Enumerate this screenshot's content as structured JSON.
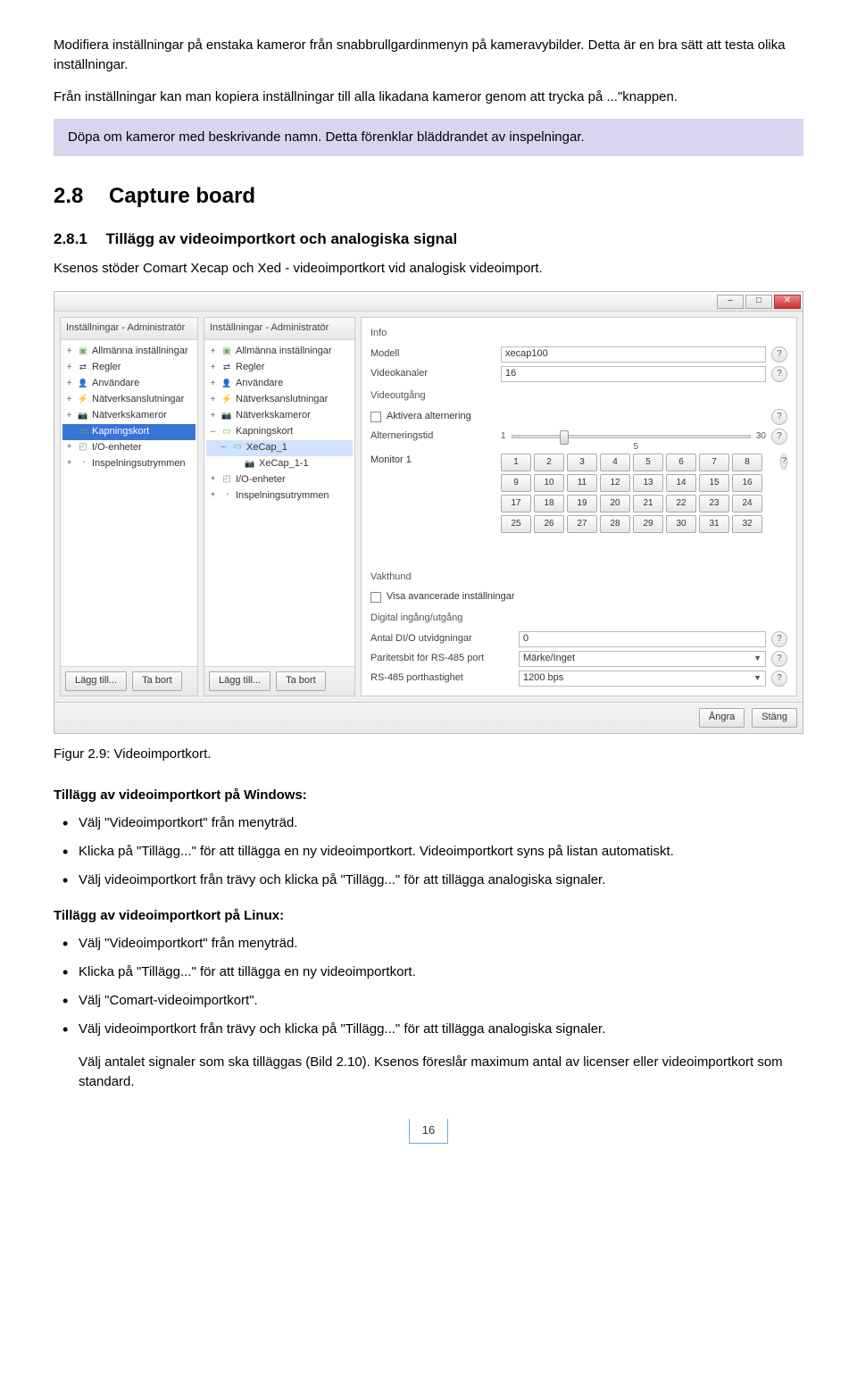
{
  "intro": {
    "p1": "Modifiera inställningar på enstaka kameror från snabbrullgardinmenyn på kameravybilder. Detta är en bra sätt att testa olika inställningar.",
    "p2": "Från inställningar kan man kopiera inställningar till alla likadana kameror genom att trycka på ...\"knappen."
  },
  "callout": "Döpa om kameror med beskrivande namn. Detta förenklar bläddrandet av inspelningar.",
  "section": {
    "num": "2.8",
    "title": "Capture board"
  },
  "subsection": {
    "num": "2.8.1",
    "title": "Tillägg av videoimportkort och analogiska signal"
  },
  "subsection_text": "Ksenos stöder Comart Xecap och Xed - videoimportkort vid analogisk videoimport.",
  "figure_caption": "Figur 2.9: Videoimportkort.",
  "windows_heading": "Tillägg av videoimportkort på Windows:",
  "windows_items": [
    "Välj \"Videoimportkort\" från menyträd.",
    "Klicka på \"Tillägg...\" för att tillägga en ny videoimportkort. Videoimportkort syns på listan automatiskt.",
    "Välj videoimportkort från trävy och klicka på \"Tillägg...\" för att tillägga analogiska signaler."
  ],
  "linux_heading": "Tillägg av videoimportkort på Linux:",
  "linux_items": [
    "Välj \"Videoimportkort\" från menyträd.",
    "Klicka på \"Tillägg...\" för att tillägga en ny videoimportkort.",
    "Välj \"Comart-videoimportkort\".",
    "Välj videoimportkort från trävy och klicka på \"Tillägg...\" för att tillägga analogiska signaler."
  ],
  "closing": "Välj antalet signaler som ska tilläggas (Bild 2.10). Ksenos föreslår maximum antal av licenser eller videoimportkort som standard.",
  "page_number": "16",
  "app": {
    "panel_title": "Inställningar - Administratör",
    "tree1": [
      {
        "exp": "+",
        "ico": "folder",
        "label": "Allmänna inställningar"
      },
      {
        "exp": "+",
        "ico": "arrows",
        "label": "Regler"
      },
      {
        "exp": "+",
        "ico": "user",
        "label": "Användare"
      },
      {
        "exp": "+",
        "ico": "net",
        "label": "Nätverksanslutningar"
      },
      {
        "exp": "+",
        "ico": "cam",
        "label": "Nätverkskameror"
      },
      {
        "exp": "",
        "ico": "card",
        "label": "Kapningskort",
        "sel": true
      },
      {
        "exp": "+",
        "ico": "dev",
        "label": "I/O-enheter"
      },
      {
        "exp": "+",
        "ico": "disk",
        "label": "Inspelningsutrymmen"
      }
    ],
    "tree2": [
      {
        "exp": "+",
        "ico": "folder",
        "label": "Allmänna inställningar"
      },
      {
        "exp": "+",
        "ico": "arrows",
        "label": "Regler"
      },
      {
        "exp": "+",
        "ico": "user",
        "label": "Användare"
      },
      {
        "exp": "+",
        "ico": "net",
        "label": "Nätverksanslutningar"
      },
      {
        "exp": "+",
        "ico": "cam",
        "label": "Nätverkskameror"
      },
      {
        "exp": "–",
        "ico": "card",
        "label": "Kapningskort"
      },
      {
        "exp": "–",
        "ico": "card",
        "label": "XeCap_1",
        "lvl": 1,
        "sel2": true
      },
      {
        "exp": "",
        "ico": "cam",
        "label": "XeCap_1-1",
        "lvl": 2
      },
      {
        "exp": "+",
        "ico": "dev",
        "label": "I/O-enheter"
      },
      {
        "exp": "+",
        "ico": "disk",
        "label": "Inspelningsutrymmen"
      }
    ],
    "footer_add": "Lägg till...",
    "footer_remove": "Ta bort",
    "info": "Info",
    "model_label": "Modell",
    "model_value": "xecap100",
    "channels_label": "Videokanaler",
    "channels_value": "16",
    "video_out": "Videoutgång",
    "alt_enable": "Aktivera alternering",
    "alt_time": "Alterneringstid",
    "slider_min": "1",
    "slider_mid": "5",
    "slider_max": "30",
    "monitor": "Monitor 1",
    "watchdog": "Vakthund",
    "show_advanced": "Visa avancerade inställningar",
    "digio": "Digital ingång/utgång",
    "dio_count_label": "Antal DI/O utvidgningar",
    "dio_count_value": "0",
    "parity_label": "Paritetsbit för RS-485 port",
    "parity_value": "Märke/Inget",
    "baud_label": "RS-485 porthastighet",
    "baud_value": "1200 bps",
    "undo": "Ångra",
    "close": "Stäng",
    "monitor_help_count": 8,
    "monitor_grid": [
      "1",
      "2",
      "3",
      "4",
      "5",
      "6",
      "7",
      "8",
      "9",
      "10",
      "11",
      "12",
      "13",
      "14",
      "15",
      "16",
      "17",
      "18",
      "19",
      "20",
      "21",
      "22",
      "23",
      "24",
      "25",
      "26",
      "27",
      "28",
      "29",
      "30",
      "31",
      "32"
    ]
  }
}
